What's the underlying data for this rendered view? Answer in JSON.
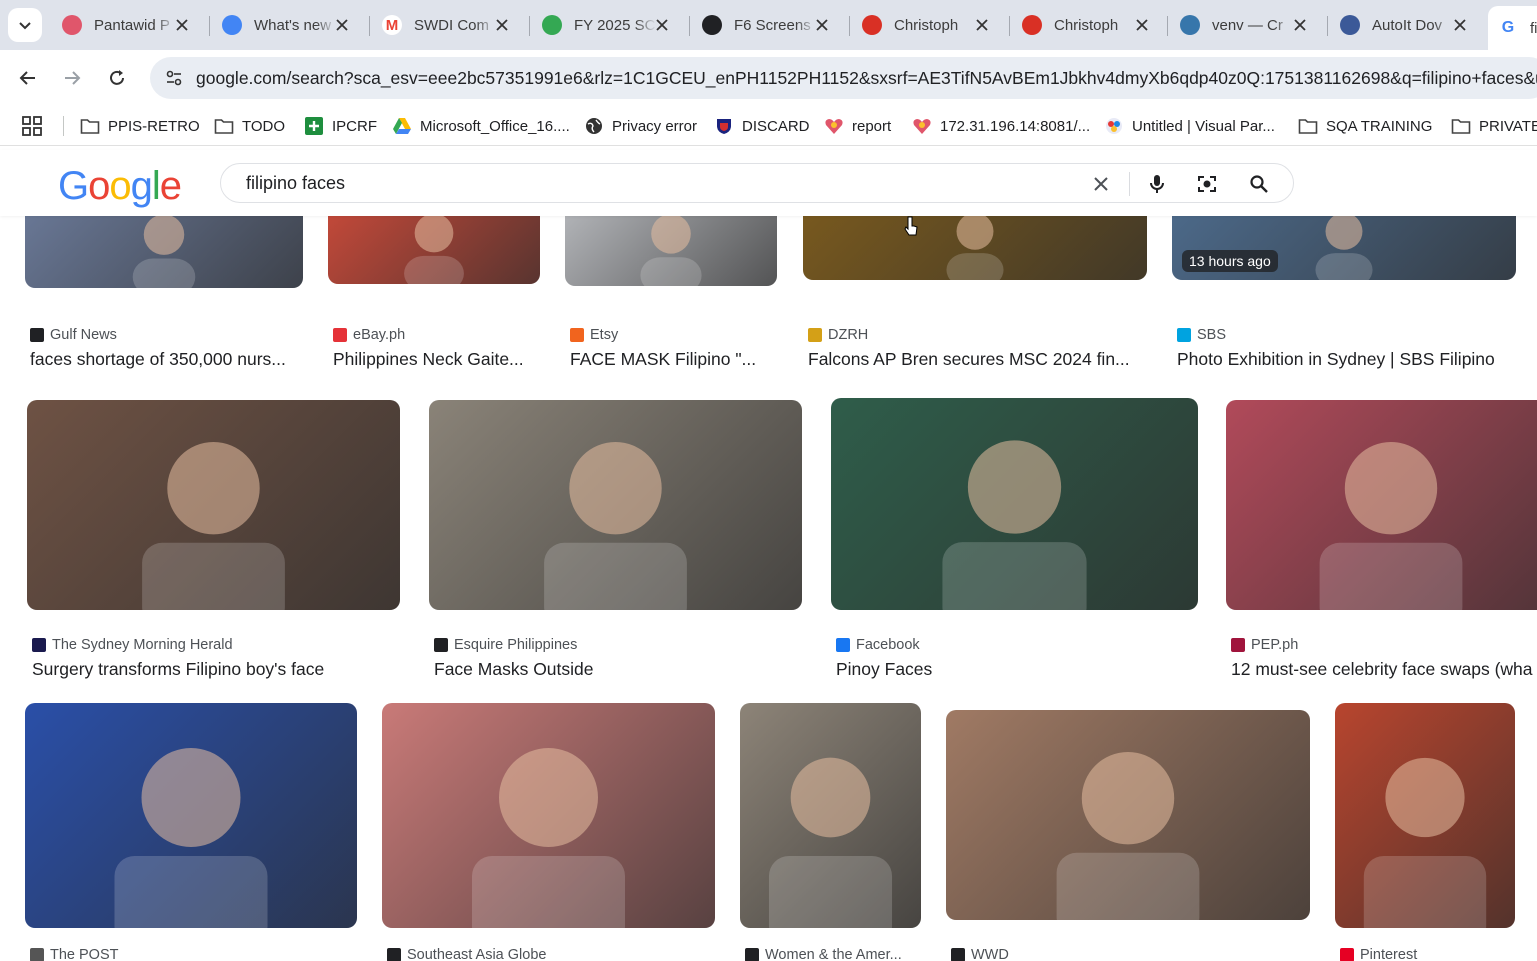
{
  "browser": {
    "tabs": [
      {
        "title": "Pantawid P",
        "favicon": "heart-logo-icon",
        "color": "#e0566b"
      },
      {
        "title": "What's new",
        "favicon": "chrome-icon",
        "color": "#4285f4"
      },
      {
        "title": "SWDI Com",
        "favicon": "gmail-icon",
        "color": "#ea4335"
      },
      {
        "title": "FY 2025 SC",
        "favicon": "google-drive-icon",
        "color": "#34a853"
      },
      {
        "title": "F6 Screens",
        "favicon": "openai-icon",
        "color": "#202124"
      },
      {
        "title": "Christoph",
        "favicon": "red-x-icon",
        "color": "#d93025"
      },
      {
        "title": "Christoph",
        "favicon": "red-x-icon",
        "color": "#d93025"
      },
      {
        "title": "venv — Cr",
        "favicon": "python-icon",
        "color": "#3776ab"
      },
      {
        "title": "AutoIt Dov",
        "favicon": "autoit-icon",
        "color": "#3b5998"
      },
      {
        "title": "fi",
        "favicon": "google-g-icon",
        "color": "#4285f4"
      }
    ],
    "url": "google.com/search?sca_esv=eee2bc57351991e6&rlz=1C1GCEU_enPH1152PH1152&sxsrf=AE3TifN5AvBEm1Jbkhv4dmyXb6qdp40z0Q:1751381162698&q=filipino+faces&udm"
  },
  "bookmarks": [
    {
      "label": "PPIS-RETRO",
      "icon": "folder-icon"
    },
    {
      "label": "TODO",
      "icon": "folder-icon"
    },
    {
      "label": "IPCRF",
      "icon": "green-plus-icon"
    },
    {
      "label": "Microsoft_Office_16....",
      "icon": "google-drive-icon"
    },
    {
      "label": "Privacy error",
      "icon": "globe-icon"
    },
    {
      "label": "DISCARD",
      "icon": "shield-icon"
    },
    {
      "label": "report",
      "icon": "heart-logo-icon"
    },
    {
      "label": "172.31.196.14:8081/...",
      "icon": "heart-logo-icon"
    },
    {
      "label": "Untitled | Visual Par...",
      "icon": "visual-paradigm-icon"
    },
    {
      "label": "SQA TRAINING",
      "icon": "folder-icon"
    },
    {
      "label": "PRIVATE",
      "icon": "folder-icon"
    }
  ],
  "google": {
    "logo": "Google",
    "query": "filipino faces"
  },
  "results": [
    {
      "source": "Gulf News",
      "title": "faces shortage of 350,000 nurs...",
      "icon_color": "#202124",
      "thumb": "#6b7a99"
    },
    {
      "source": "eBay.ph",
      "title": "Philippines Neck Gaite...",
      "icon_color": "#e53238",
      "thumb": "#c94a3a"
    },
    {
      "source": "Etsy",
      "title": "FACE MASK Filipino \"...",
      "icon_color": "#f1641e",
      "thumb": "#b7b9bd"
    },
    {
      "source": "DZRH",
      "title": "Falcons AP Bren secures MSC 2024 fin...",
      "icon_color": "#d4a017",
      "thumb": "#7a5a1e"
    },
    {
      "source": "SBS",
      "title": "Photo Exhibition in Sydney | SBS Filipino",
      "icon_color": "#00a3e0",
      "thumb": "#4d6b8c",
      "badge": "13 hours ago"
    },
    {
      "source": "The Sydney Morning Herald",
      "title": "Surgery transforms Filipino boy's face",
      "icon_color": "#1a1a4e",
      "thumb": "#6e5244"
    },
    {
      "source": "Esquire Philippines",
      "title": "Face Masks Outside",
      "icon_color": "#202124",
      "thumb": "#8a8378"
    },
    {
      "source": "Facebook",
      "title": "Pinoy Faces",
      "icon_color": "#1877f2",
      "thumb": "#2f5d4a"
    },
    {
      "source": "PEP.ph",
      "title": "12 must-see celebrity face swaps (wha",
      "icon_color": "#a0143c",
      "thumb": "#b14a5a"
    },
    {
      "source": "The POST",
      "title": "",
      "icon_color": "#555555",
      "thumb": "#2a4fa8"
    },
    {
      "source": "Southeast Asia Globe",
      "title": "",
      "icon_color": "#202124",
      "thumb": "#c97a78"
    },
    {
      "source": "Women & the Amer...",
      "title": "",
      "icon_color": "#202124",
      "thumb": "#8d8478"
    },
    {
      "source": "WWD",
      "title": "",
      "icon_color": "#202124",
      "thumb": "#a07a64"
    },
    {
      "source": "Pinterest",
      "title": "",
      "icon_color": "#e60023",
      "thumb": "#b8452e"
    }
  ]
}
